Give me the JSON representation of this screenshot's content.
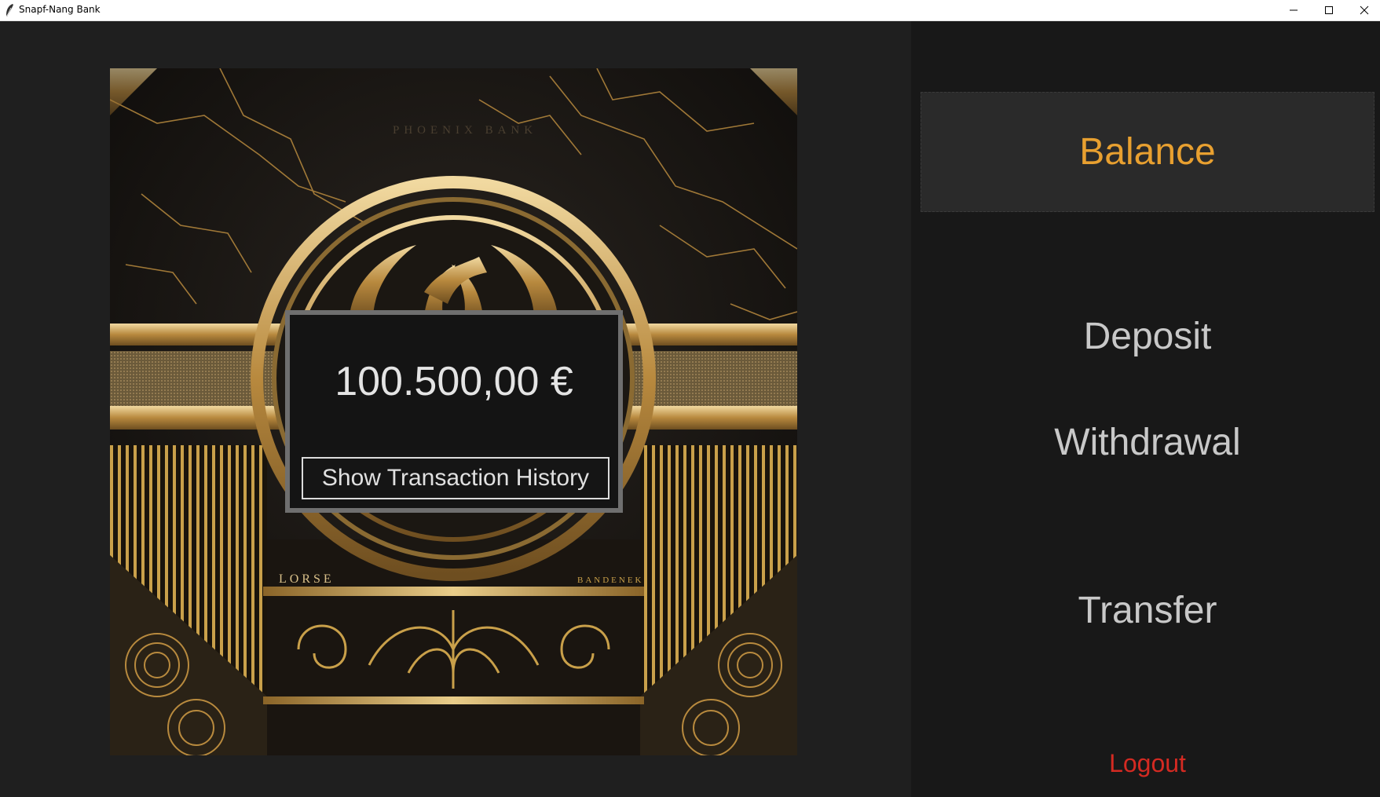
{
  "window": {
    "title": "Snapf-Nang Bank",
    "icons": {
      "app": "feather-icon",
      "minimize": "minimize-icon",
      "maximize": "maximize-icon",
      "close": "close-icon"
    }
  },
  "art": {
    "text_left": "LORSE",
    "text_right": "BANDENEK",
    "text_top": "PHOENIX BANK"
  },
  "balance_card": {
    "amount": "100.500,00 €",
    "history_button": "Show Transaction History"
  },
  "menu": {
    "balance": "Balance",
    "deposit": "Deposit",
    "withdrawal": "Withdrawal",
    "transfer": "Transfer",
    "logout": "Logout"
  },
  "colors": {
    "accent_active": "#e8a030",
    "logout": "#d42a22",
    "menu_text": "#c8c8c8",
    "gold": "#c9a04a"
  }
}
